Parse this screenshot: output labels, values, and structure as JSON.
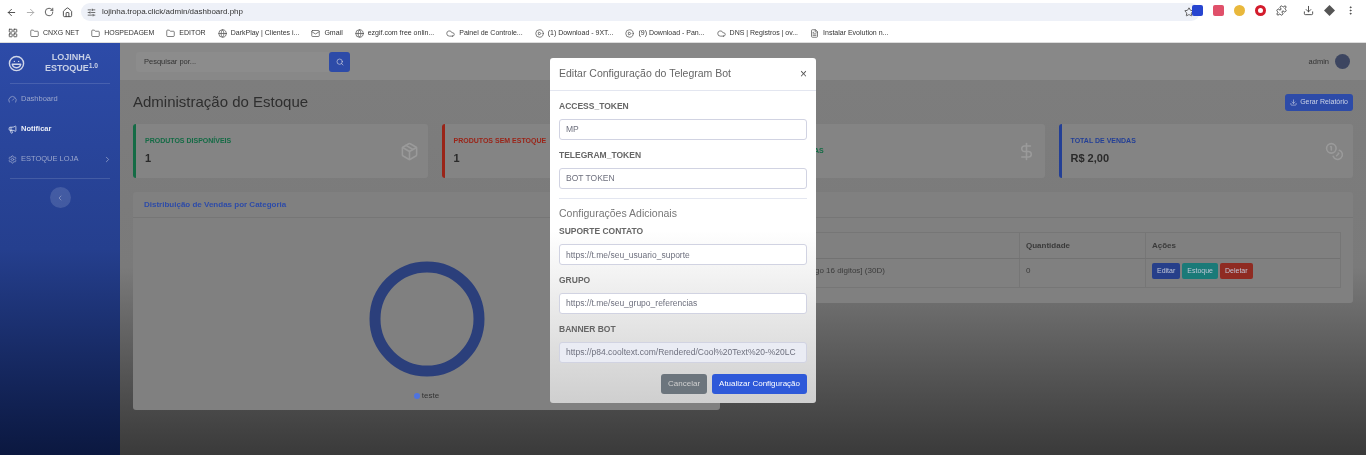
{
  "browser": {
    "url": "lojinha.tropa.click/admin/dashboard.php",
    "bookmarks": [
      {
        "label": "CNXG NET",
        "kind": "folder"
      },
      {
        "label": "HOSPEDAGEM",
        "kind": "folder"
      },
      {
        "label": "EDITOR",
        "kind": "folder"
      },
      {
        "label": "DarkPlay | Clientes i...",
        "kind": "site"
      },
      {
        "label": "Gmail",
        "kind": "mail"
      },
      {
        "label": "ezgif.com free onlin...",
        "kind": "site"
      },
      {
        "label": "Painel de Controle...",
        "kind": "cloud"
      },
      {
        "label": "(1) Download - 9XT...",
        "kind": "video"
      },
      {
        "label": "(9) Download - Pan...",
        "kind": "video"
      },
      {
        "label": "DNS | Registros | ov...",
        "kind": "cloud"
      },
      {
        "label": "Instalar Evolution n...",
        "kind": "doc"
      }
    ]
  },
  "sidebar": {
    "brand": "LOJINHA",
    "brand_sub": "ESTOQUE$^{1.0}$",
    "items": [
      {
        "label": "Dashboard",
        "kind": "dashboard",
        "selected": false,
        "submenu": false
      },
      {
        "label": "Notificar",
        "kind": "notify",
        "selected": true,
        "submenu": false
      },
      {
        "label": "ESTOQUE LOJA",
        "kind": "settings",
        "selected": false,
        "submenu": true
      }
    ]
  },
  "topbar": {
    "search_placeholder": "Pesquisar por...",
    "user": "admin"
  },
  "page_title": "Administração do Estoque",
  "report_button": "Gerar Relatório",
  "cards": [
    {
      "label": "PRODUTOS DISPONÍVEIS",
      "value": "1",
      "color": "#146b45"
    },
    {
      "label": "PRODUTOS SEM ESTOQUE",
      "value": "1",
      "color": "#9a2418"
    },
    {
      "label": "AS",
      "color": "#146b45"
    },
    {
      "label": "TOTAL DE VENDAS",
      "value": "R$ 2,00",
      "color": "#233f96"
    }
  ],
  "chart_panel": {
    "title": "Distribuição de Vendas por Categoria",
    "legend": [
      {
        "label": "teste",
        "color": "#4e73df"
      }
    ]
  },
  "table": {
    "columns": [
      "Quantidade",
      "Ações"
    ],
    "rows": [
      {
        "product": "go 16 digitos] (30D)",
        "quantity": "0",
        "actions": [
          {
            "label": "Editar",
            "kind": "edit"
          },
          {
            "label": "Estoque",
            "kind": "stock"
          },
          {
            "label": "Deletar",
            "kind": "delete"
          }
        ]
      }
    ]
  },
  "modal": {
    "title": "Editar Configuração do Telegram Bot",
    "close": "×",
    "fields": [
      {
        "label": "ACCESS_TOKEN",
        "value": "MP",
        "readonly": false
      },
      {
        "label": "TELEGRAM_TOKEN",
        "value": "BOT TOKEN",
        "readonly": false
      }
    ],
    "section": {
      "title": "Configurações Adicionais",
      "fields": [
        {
          "label": "SUPORTE CONTATO",
          "value": "https://t.me/seu_usuario_suporte",
          "readonly": false
        },
        {
          "label": "GRUPO",
          "value": "https://t.me/seu_grupo_referencias",
          "readonly": false
        },
        {
          "label": "BANNER BOT",
          "value": "https://p84.cooltext.com/Rendered/Cool%20Text%20-%20LC",
          "readonly": true
        }
      ]
    },
    "buttons": [
      {
        "label": "Cancelar",
        "kind": "secondary"
      },
      {
        "label": "Atualizar Configuração",
        "kind": "primary"
      }
    ]
  }
}
